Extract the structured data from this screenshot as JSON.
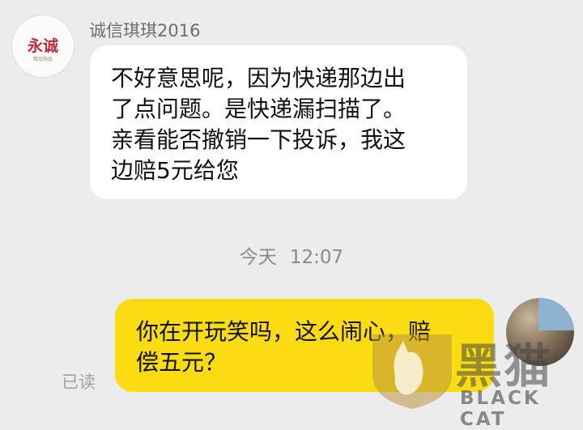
{
  "contact": {
    "name": "诚信琪琪2016",
    "avatar_text": "永诚",
    "avatar_subtext": "精品饰品"
  },
  "messages": [
    {
      "side": "left",
      "lines": [
        "不好意思呢，因为快递那边出",
        "了点问题。是快递漏扫描了。",
        "亲看能否撤销一下投诉，我这",
        "边赔5元给您"
      ]
    },
    {
      "side": "right",
      "lines": [
        "你在开玩笑吗，这么闹心，赔",
        "偿五元？"
      ],
      "status": "已读"
    }
  ],
  "timestamp": {
    "day": "今天",
    "time": "12:07"
  },
  "watermark": {
    "cn": "黑猫",
    "en": "BLACK CAT"
  },
  "colors": {
    "background": "#ececec",
    "outgoing_bubble": "#fbdc12",
    "incoming_bubble": "#ffffff"
  }
}
